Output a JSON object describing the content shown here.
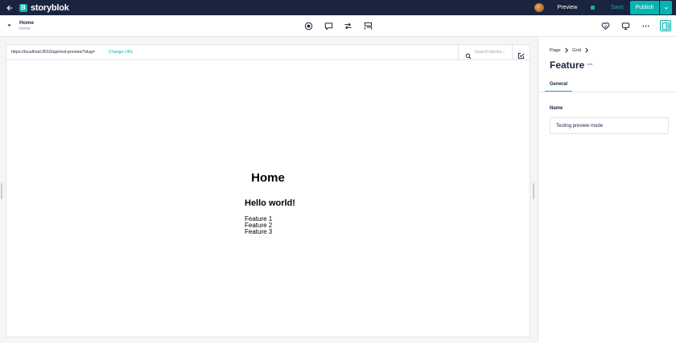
{
  "topbar": {
    "logo_text": "storyblok",
    "logo_letter": "B",
    "preview_label": "Preview",
    "save_label": "Save",
    "publish_label": "Publish",
    "accent_color": "#09b3af",
    "bar_color": "#1b243f"
  },
  "story": {
    "name": "Home",
    "slug": "home"
  },
  "toolbar": {
    "center_icons": [
      "target-icon",
      "comment-icon",
      "switch-icon",
      "blocks-icon"
    ],
    "right_icons": [
      "heart-icon",
      "monitor-icon",
      "more-icon",
      "layout-icon"
    ]
  },
  "preview": {
    "url": "https://localhost:3010/api/exit-preview?slug=",
    "change_url_label": "Change URL",
    "search_placeholder": "Search blocks...",
    "heading": "Home",
    "subheading": "Hello world!",
    "features": [
      "Feature 1",
      "Feature 2",
      "Feature 3"
    ]
  },
  "sidebar": {
    "breadcrumb": [
      "Page",
      "Grid"
    ],
    "block_title": "Feature",
    "tab_label": "General",
    "field_label": "Name",
    "field_value": "Testing preview mode"
  }
}
